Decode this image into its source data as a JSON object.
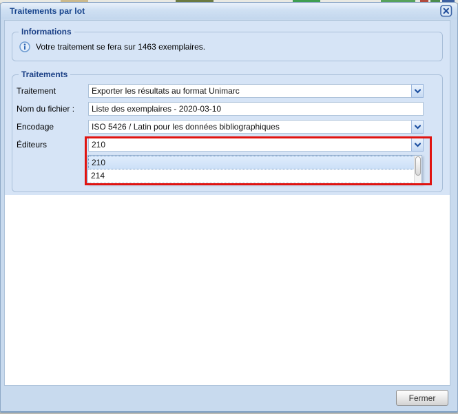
{
  "window": {
    "title": "Traitements par lot"
  },
  "informations": {
    "legend": "Informations",
    "message": "Votre traitement se fera sur 1463 exemplaires."
  },
  "traitements": {
    "legend": "Traitements",
    "traitement": {
      "label": "Traitement",
      "value": "Exporter les résultats au format Unimarc"
    },
    "nom_fichier": {
      "label": "Nom du fichier :",
      "value": "Liste des exemplaires - 2020-03-10"
    },
    "encodage": {
      "label": "Encodage",
      "value": "ISO 5426 / Latin pour les données bibliographiques"
    },
    "editeurs": {
      "label": "Éditeurs",
      "value": "210",
      "options": [
        "210",
        "214"
      ],
      "highlighted_option": "210"
    }
  },
  "footer": {
    "close_label": "Fermer"
  },
  "icons": {
    "close": "close-x",
    "info": "info-circle",
    "combo_trigger": "chevron-down"
  },
  "annotation": {
    "shape": "rectangle",
    "color": "#e01310",
    "purpose": "highlights the Éditeurs combo box and its open option list"
  },
  "colors": {
    "title_text": "#15428b",
    "legend_text": "#1b4086",
    "window_chrome": "#c8daee",
    "form_background": "#d6e4f6",
    "selected_option_background": "#d8e7fa",
    "annotation_red": "#e01310"
  }
}
